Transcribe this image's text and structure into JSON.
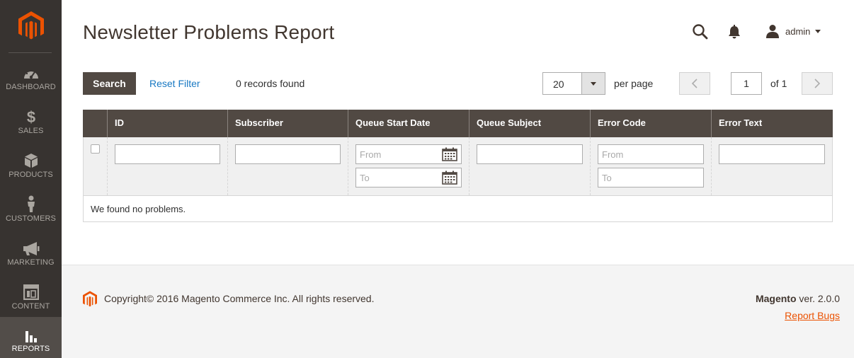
{
  "sidebar": {
    "items": [
      {
        "label": "DASHBOARD",
        "icon": "dashboard-icon"
      },
      {
        "label": "SALES",
        "icon": "dollar-icon"
      },
      {
        "label": "PRODUCTS",
        "icon": "box-icon"
      },
      {
        "label": "CUSTOMERS",
        "icon": "person-icon"
      },
      {
        "label": "MARKETING",
        "icon": "megaphone-icon"
      },
      {
        "label": "CONTENT",
        "icon": "layout-icon"
      },
      {
        "label": "REPORTS",
        "icon": "bar-chart-icon"
      }
    ],
    "active": "REPORTS"
  },
  "header": {
    "title": "Newsletter Problems Report",
    "user": "admin"
  },
  "toolbar": {
    "search_label": "Search",
    "reset_label": "Reset Filter",
    "records_text": "0 records found",
    "per_page_value": "20",
    "per_page_label": "per page",
    "page_value": "1",
    "page_of": "of 1"
  },
  "grid": {
    "columns": [
      "ID",
      "Subscriber",
      "Queue Start Date",
      "Queue Subject",
      "Error Code",
      "Error Text"
    ],
    "filters": {
      "date_from_placeholder": "From",
      "date_to_placeholder": "To",
      "code_from_placeholder": "From",
      "code_to_placeholder": "To"
    },
    "empty_text": "We found no problems."
  },
  "footer": {
    "copyright": "Copyright© 2016 Magento Commerce Inc. All rights reserved.",
    "brand": "Magento",
    "version": " ver. 2.0.0",
    "report_bugs": "Report Bugs"
  },
  "colors": {
    "brand_orange": "#eb5202",
    "sidebar_bg": "#373330",
    "header_bg": "#514943",
    "link_blue": "#1979c3"
  }
}
